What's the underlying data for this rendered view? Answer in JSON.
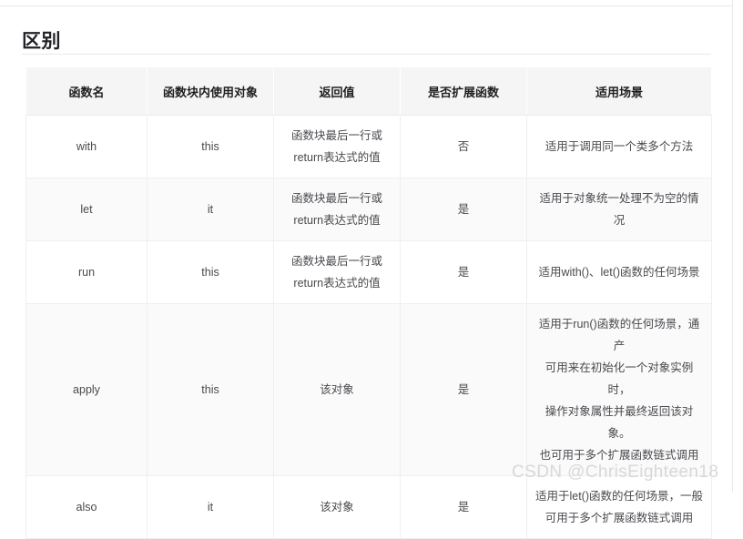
{
  "page": {
    "title": "区别",
    "watermark": "CSDN @ChrisEighteen18"
  },
  "table": {
    "headers": [
      "函数名",
      "函数块内使用对象",
      "返回值",
      "是否扩展函数",
      "适用场景"
    ],
    "rows": [
      {
        "name": "with",
        "scope_object": "this",
        "return_value_line1": "函数块最后一行或",
        "return_value_line2": "return表达式的值",
        "is_extension": "否",
        "usage_lines": [
          "适用于调用同一个类多个方法"
        ]
      },
      {
        "name": "let",
        "scope_object": "it",
        "return_value_line1": "函数块最后一行或",
        "return_value_line2": "return表达式的值",
        "is_extension": "是",
        "usage_lines": [
          "适用于对象统一处理不为空的情况"
        ]
      },
      {
        "name": "run",
        "scope_object": "this",
        "return_value_line1": "函数块最后一行或",
        "return_value_line2": "return表达式的值",
        "is_extension": "是",
        "usage_lines": [
          "适用with()、let()函数的任何场景"
        ]
      },
      {
        "name": "apply",
        "scope_object": "this",
        "return_value_line1": "该对象",
        "return_value_line2": "",
        "is_extension": "是",
        "usage_lines": [
          "适用于run()函数的任何场景，通产",
          "可用来在初始化一个对象实例时，",
          "操作对象属性并最终返回该对象。",
          "也可用于多个扩展函数链式调用"
        ]
      },
      {
        "name": "also",
        "scope_object": "it",
        "return_value_line1": "该对象",
        "return_value_line2": "",
        "is_extension": "是",
        "usage_lines": [
          "适用于let()函数的任何场景，一般",
          "可用于多个扩展函数链式调用"
        ]
      }
    ]
  }
}
